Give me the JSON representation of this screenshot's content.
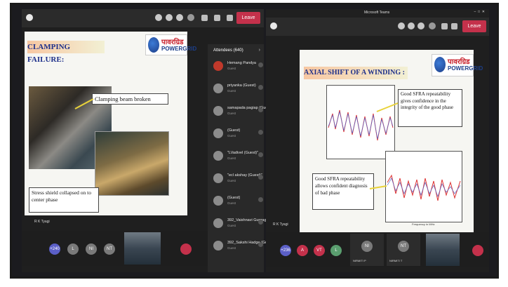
{
  "left_window": {
    "leave_label": "Leave",
    "presenter_label": "R K Tyagi",
    "slide": {
      "title": "CLAMPING FAILURE:",
      "logo_hindi": "पावरग्रिड",
      "logo_english": "POWERGRID",
      "callout_top": "Clamping beam broken",
      "callout_bottom": "Stress shield collapsed on to center phase"
    },
    "bottom_avatars": [
      {
        "initials": "+240",
        "color": "#5b5fc7"
      },
      {
        "initials": "L",
        "color": "#7a7a7a"
      },
      {
        "initials": "NI",
        "color": "#7a7a7a"
      },
      {
        "initials": "NT",
        "color": "#7a7a7a"
      }
    ]
  },
  "attendees_panel": {
    "title": "Attendees (640)",
    "items": [
      {
        "name": "Hemang Pandya",
        "sub": "Guest"
      },
      {
        "name": "priyanka (Guest)",
        "sub": "Guest"
      },
      {
        "name": "samapada pagiap (Guest)",
        "sub": "Guest"
      },
      {
        "name": "(Guest)",
        "sub": "Guest"
      },
      {
        "name": "\"LVadivel (Guest)\"",
        "sub": "Guest"
      },
      {
        "name": "\"ecl akshay (Guest)\"",
        "sub": "Guest"
      },
      {
        "name": "(Guest)",
        "sub": "Guest"
      },
      {
        "name": "392_Vaishnavi Gurgaguer...",
        "sub": "Guest"
      },
      {
        "name": "392_Sakshi Hadge (Guest)",
        "sub": "Guest"
      }
    ]
  },
  "right_window": {
    "window_title": "Microsoft Teams",
    "leave_label": "Leave",
    "presenter_label": "R K Tyagi",
    "slide": {
      "title": "AXIAL SHIFT OF A WINDING :",
      "logo_hindi": "पावरग्रिड",
      "logo_english": "POWERGRID",
      "callout_top": "Good SFRA repeatability gives confidence in the integrity of the good phase",
      "callout_bottom": "Good SFRA repeatability allows confident diagnosis of bad phase",
      "plot_xlabel": "Frequency in MHz"
    },
    "bottom_avatars": [
      {
        "initials": "+236",
        "color": "#5b5fc7"
      },
      {
        "initials": "A",
        "color": "#c4314b"
      },
      {
        "initials": "VT",
        "color": "#c4314b"
      },
      {
        "initials": "L",
        "color": "#5a9e6f"
      },
      {
        "initials": "NI",
        "color": "#7a7a7a"
      },
      {
        "initials": "NT",
        "color": "#7a7a7a"
      }
    ],
    "tile_labels": [
      "NIRMITI P",
      "NIRMITI T"
    ]
  }
}
